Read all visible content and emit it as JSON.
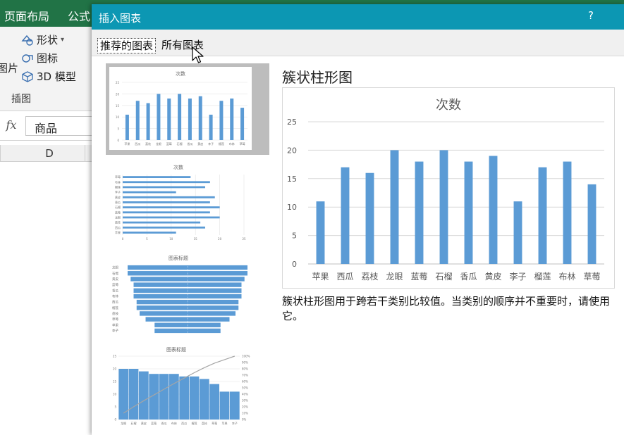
{
  "excel": {
    "ribbon_tabs": [
      "页面布局",
      "公式"
    ],
    "ribbon_items": [
      "形状",
      "图标",
      "3D 模型"
    ],
    "picture_label": "图片",
    "group_label": "插图",
    "fx_label": "fx",
    "name_box_value": "商品",
    "column_header": "D"
  },
  "dialog": {
    "title": "插入图表",
    "help": "?",
    "tabs": [
      {
        "label": "推荐的图表",
        "active": true
      },
      {
        "label": "所有图表",
        "active": false
      }
    ],
    "preview_title": "簇状柱形图",
    "description": "簇状柱形图用于跨若干类别比较值。当类别的顺序并不重要时，请使用它。"
  },
  "thumbnails": {
    "t1_title": "次数",
    "t2_title": "次数",
    "t3_title": "图表标题",
    "t4_title": "图表标题"
  },
  "colors": {
    "bar": "#5b9bd5",
    "title_bar": "#0c97b3",
    "excel_green": "#217346"
  },
  "chart_data": {
    "type": "bar",
    "title": "次数",
    "categories": [
      "苹果",
      "西瓜",
      "荔枝",
      "龙眼",
      "蓝莓",
      "石榴",
      "香瓜",
      "黄皮",
      "李子",
      "榴莲",
      "布林",
      "草莓"
    ],
    "values": [
      11,
      17,
      16,
      20,
      18,
      20,
      18,
      19,
      11,
      17,
      18,
      14
    ],
    "ylim": [
      0,
      25
    ],
    "yticks": [
      0,
      5,
      10,
      15,
      20,
      25
    ],
    "grid": true,
    "legend": "none"
  }
}
